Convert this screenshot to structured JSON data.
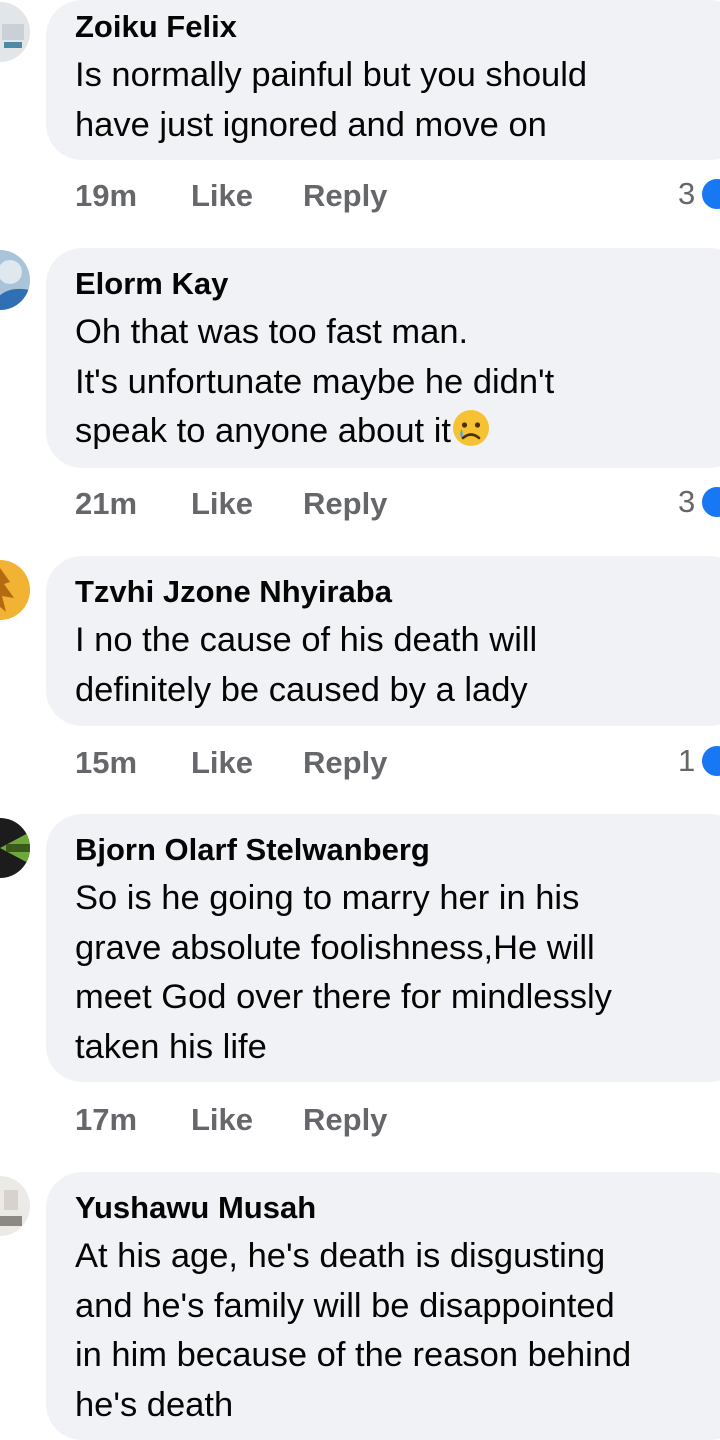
{
  "action_labels": {
    "like": "Like",
    "reply": "Reply"
  },
  "colors": {
    "bubble": "#f0f2f5",
    "meta_text": "#65676b",
    "reaction_blue": "#1877f2"
  },
  "comments": [
    {
      "author": "Zoiku Felix",
      "text": "Is normally painful but you should\nhave just ignored and move on",
      "time": "19m",
      "reaction_count": "3",
      "reaction_icon": "like-icon"
    },
    {
      "author": "Elorm Kay",
      "text": "Oh that was too fast man.\nIt's unfortunate maybe he didn't\nspeak to anyone about it",
      "text_emoji": "crying-face-emoji",
      "time": "21m",
      "reaction_count": "3",
      "reaction_icon": "like-icon"
    },
    {
      "author": "Tzvhi Jzone Nhyiraba",
      "text": "I no the cause of his death will\ndefinitely be caused by a lady",
      "time": "15m",
      "reaction_count": "1",
      "reaction_icon": "like-icon"
    },
    {
      "author": "Bjorn Olarf Stelwanberg",
      "text": "So is he going to marry her in his\ngrave absolute foolishness,He will\nmeet God over there for mindlessly\ntaken his life",
      "time": "17m"
    },
    {
      "author": "Yushawu Musah",
      "text": "At his age, he's death is disgusting\nand he's family will be disappointed\nin him because of the reason behind\nhe's death"
    }
  ]
}
